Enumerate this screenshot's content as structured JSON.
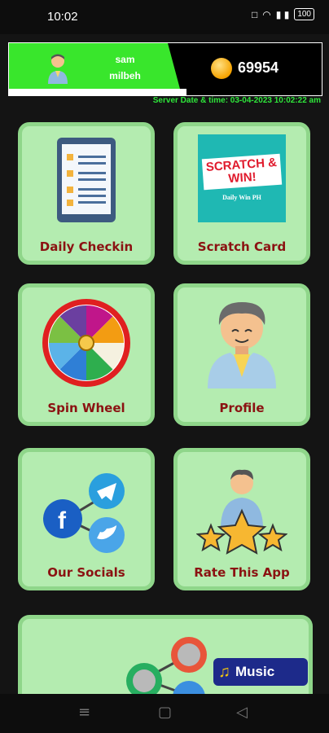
{
  "status_bar": {
    "time": "10:02",
    "signal": "▮ ▮",
    "battery": "100"
  },
  "header": {
    "user_name_line1": "sam",
    "user_name_line2": "milbeh",
    "coins": "69954"
  },
  "server": {
    "text": "Server Date & time:  03-04-2023 10:02:22 am"
  },
  "cards": [
    {
      "label": "Daily Checkin"
    },
    {
      "label": "Scratch Card",
      "art_title": "SCRATCH & WIN!",
      "art_subtitle": "Daily Win PH"
    },
    {
      "label": "Spin Wheel"
    },
    {
      "label": "Profile"
    },
    {
      "label": "Our Socials"
    },
    {
      "label": "Rate This App"
    }
  ],
  "music_button": {
    "label": "Music"
  },
  "colors": {
    "accent_green": "#39e62c",
    "card_bg": "#b4ecb0",
    "card_border": "#8fd68a",
    "label_red": "#8b1212",
    "server_text": "#2ee63a"
  }
}
